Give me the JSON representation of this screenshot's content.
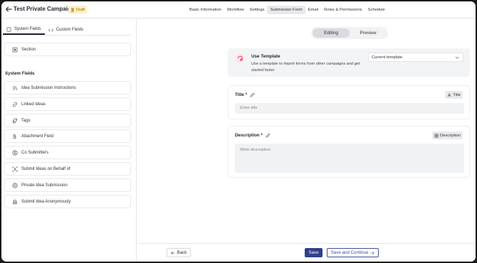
{
  "header": {
    "title": "Test Private Campaign",
    "badge": "Draft",
    "nav": [
      {
        "label": "Basic Information",
        "name": "nav-basic-information",
        "active": false
      },
      {
        "label": "Workflow",
        "name": "nav-workflow",
        "active": false
      },
      {
        "label": "Settings",
        "name": "nav-settings",
        "active": false
      },
      {
        "label": "Submission Form",
        "name": "nav-submission-form",
        "active": true
      },
      {
        "label": "Email",
        "name": "nav-email",
        "active": false
      },
      {
        "label": "Roles & Permissions",
        "name": "nav-roles-permissions",
        "active": false
      },
      {
        "label": "Schedule",
        "name": "nav-schedule",
        "active": false
      }
    ]
  },
  "left": {
    "tabs": {
      "system": "System Fields",
      "custom": "Custom Fields"
    },
    "section_item": "Section",
    "system_heading": "System Fields",
    "fields": [
      {
        "label": "Idea Submission Instructions",
        "icon": "instructions-icon"
      },
      {
        "label": "Linked Ideas",
        "icon": "link-icon"
      },
      {
        "label": "Tags",
        "icon": "tag-icon"
      },
      {
        "label": "Attachment Field",
        "icon": "paperclip-icon"
      },
      {
        "label": "Co Submitters",
        "icon": "user-circle-icon"
      },
      {
        "label": "Submit Ideas on Behalf of",
        "icon": "user-scan-icon"
      },
      {
        "label": "Private Idea Submission",
        "icon": "private-icon"
      },
      {
        "label": "Submit Idea Anonymously",
        "icon": "anonymous-icon"
      }
    ]
  },
  "mode": {
    "editing": "Editing",
    "preview": "Preview"
  },
  "template": {
    "title": "Use Template",
    "description": "Use a template to import forms from other campaigns and get started faster",
    "select_value": "Current template"
  },
  "title_field": {
    "label": "Title *",
    "chip": "Title",
    "placeholder": "Enter title"
  },
  "description_field": {
    "label": "Description *",
    "chip": "Description",
    "placeholder": "Write description"
  },
  "footer": {
    "back": "Back",
    "save": "Save",
    "save_continue": "Save and Continue"
  },
  "colors": {
    "primary": "#2f3f8a",
    "draft_badge_bg": "#fdf0c4",
    "template_accent": "#e8506e"
  }
}
